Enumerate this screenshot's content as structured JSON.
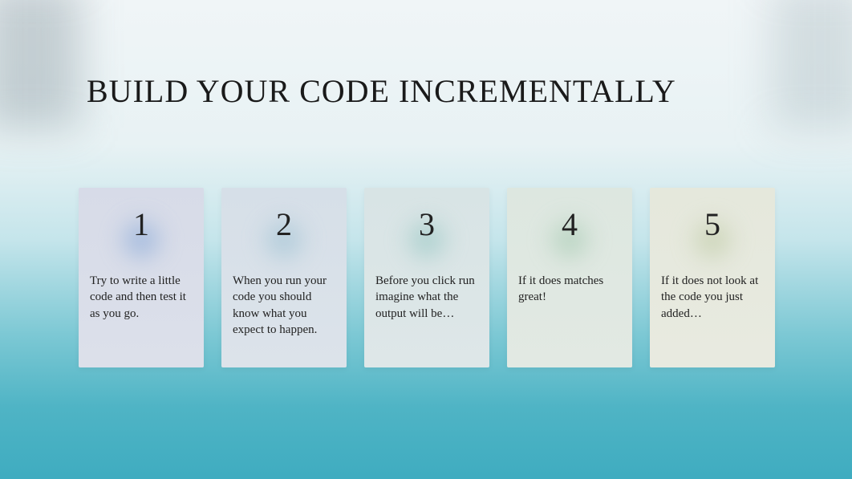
{
  "title": "BUILD YOUR CODE INCREMENTALLY",
  "cards": [
    {
      "number": "1",
      "text": "Try to write a little code and then test it as you go."
    },
    {
      "number": "2",
      "text": "When you run your code you should know what you expect to happen."
    },
    {
      "number": "3",
      "text": "Before you click run imagine what the output will be…"
    },
    {
      "number": "4",
      "text": "If it does matches great!"
    },
    {
      "number": "5",
      "text": "If it does not look at the code you just added…"
    }
  ]
}
